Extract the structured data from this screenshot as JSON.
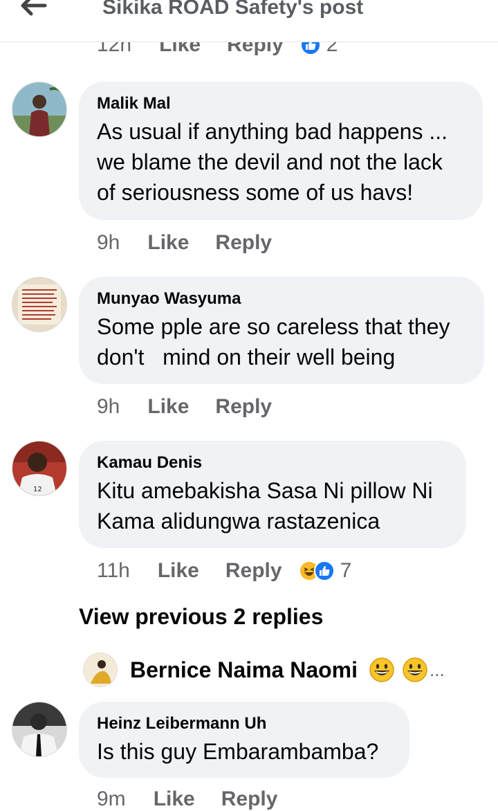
{
  "header": {
    "title": "Sikika ROAD Safety's post",
    "back_icon": "back-arrow-icon"
  },
  "actions": {
    "like": "Like",
    "reply": "Reply"
  },
  "top_meta": {
    "time": "12h",
    "reaction_count": "2",
    "reactions": [
      "like"
    ]
  },
  "comments": [
    {
      "name": "Malik Mal",
      "text": "As usual if anything bad happens ...\nwe blame the devil and not the lack\nof seriousness some of us havs!",
      "time": "9h"
    },
    {
      "name": "Munyao Wasyuma",
      "text": "Some pple are so careless that they\ndon't   mind on their well being",
      "time": "9h"
    },
    {
      "name": "Kamau Denis",
      "text": "Kitu amebakisha Sasa Ni pillow Ni\nKama alidungwa rastazenica",
      "time": "11h",
      "reaction_count": "7",
      "reactions": [
        "haha",
        "like"
      ]
    },
    {
      "name": "Heinz Leibermann Uh",
      "text": "Is this guy Embarambamba?",
      "time": "9m"
    }
  ],
  "view_previous": "View previous 2 replies",
  "reply_preview": {
    "name": "Bernice Naima Naomi",
    "emojis": [
      "grinning-face",
      "grinning-face"
    ],
    "ellipsis": "..."
  },
  "colors": {
    "bubble": "#f0f2f5",
    "meta_text": "#65676b",
    "like_blue": "#1877f2",
    "haha_yellow": "#f7b928"
  }
}
